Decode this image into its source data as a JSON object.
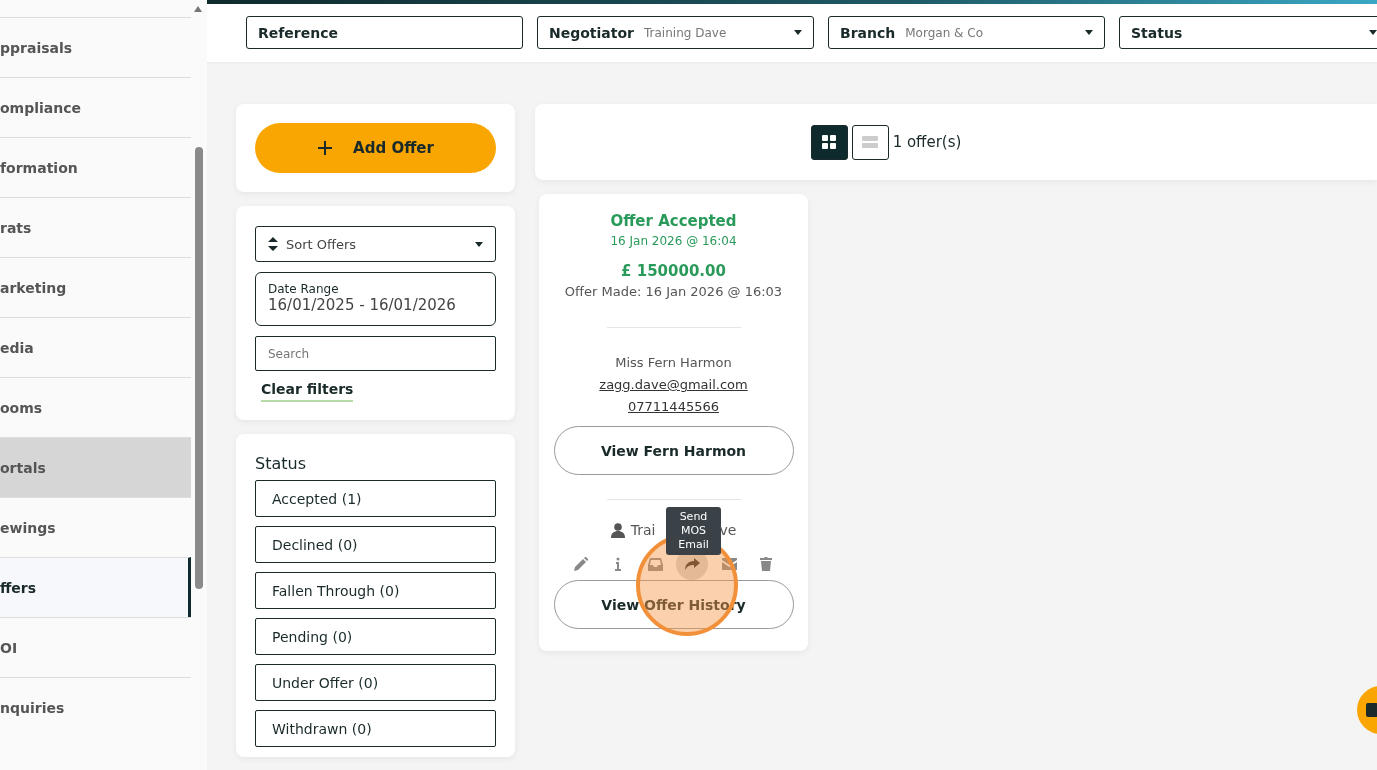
{
  "sidebar": {
    "items": [
      {
        "label": "ppraisals",
        "selected": false,
        "hovered": false
      },
      {
        "label": "ompliance",
        "selected": false,
        "hovered": false
      },
      {
        "label": "formation",
        "selected": false,
        "hovered": false
      },
      {
        "label": "rats",
        "selected": false,
        "hovered": false
      },
      {
        "label": "arketing",
        "selected": false,
        "hovered": false
      },
      {
        "label": "edia",
        "selected": false,
        "hovered": false
      },
      {
        "label": "ooms",
        "selected": false,
        "hovered": false
      },
      {
        "label": "ortals",
        "selected": false,
        "hovered": true
      },
      {
        "label": "ewings",
        "selected": false,
        "hovered": false
      },
      {
        "label": "ffers",
        "selected": true,
        "hovered": false
      },
      {
        "label": "OI",
        "selected": false,
        "hovered": false
      },
      {
        "label": "nquiries",
        "selected": false,
        "hovered": false
      }
    ]
  },
  "filters": [
    {
      "label": "Reference"
    },
    {
      "label": "Negotiator",
      "value": "Training Dave"
    },
    {
      "label": "Branch",
      "value": "Morgan & Co"
    },
    {
      "label": "Status"
    }
  ],
  "add_button": "Add Offer",
  "sort": {
    "label": "Sort Offers"
  },
  "date_range": {
    "label": "Date Range",
    "value": "16/01/2025 - 16/01/2026"
  },
  "search": {
    "placeholder": "Search"
  },
  "clear_filters": "Clear filters",
  "status_panel": {
    "title": "Status",
    "options": [
      {
        "label": "Accepted (1)"
      },
      {
        "label": "Declined (0)"
      },
      {
        "label": "Fallen Through (0)"
      },
      {
        "label": "Pending (0)"
      },
      {
        "label": "Under Offer (0)"
      },
      {
        "label": "Withdrawn (0)"
      }
    ]
  },
  "view_toggle": [
    {
      "kind": "grid",
      "selected": true
    },
    {
      "kind": "list",
      "selected": false
    }
  ],
  "count": "1 offer(s)",
  "offer": {
    "status": "Offer Accepted",
    "status_date": "16 Jan 2026 @ 16:04",
    "amount": "£ 150000.00",
    "made": "Offer Made: 16 Jan 2026 @ 16:03",
    "name": "Miss Fern Harmon",
    "email": "zagg.dave@gmail.com",
    "phone": "07711445566",
    "view_button": "View Fern Harmon",
    "agent_visible": [
      "Trai",
      "ve"
    ],
    "history_button": "View Offer History",
    "actions": [
      {
        "kind": "edit",
        "highlighted": false
      },
      {
        "kind": "info",
        "highlighted": false
      },
      {
        "kind": "inbox",
        "highlighted": false
      },
      {
        "kind": "forward",
        "highlighted": true
      },
      {
        "kind": "mail",
        "highlighted": false
      },
      {
        "kind": "delete",
        "highlighted": false
      }
    ],
    "tooltip": "Send MOS Email"
  }
}
